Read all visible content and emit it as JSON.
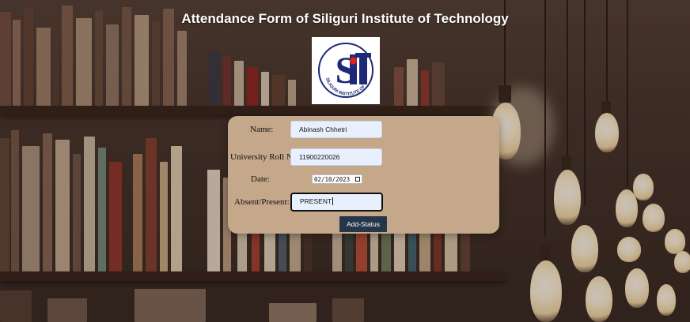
{
  "header": {
    "title": "Attendance Form of Siliguri Institute of Technology"
  },
  "logo": {
    "letters": "SIT",
    "ring_text": "SILIGURI INSTITUTE OF TECHNOLOGY",
    "accent": "#e2231a",
    "brand": "#1e2a78"
  },
  "form": {
    "name_label": "Name:",
    "name_value": "Abinash Chhetri",
    "roll_label": "University Roll No:",
    "roll_value": "11900220026",
    "date_label": "Date:",
    "date_value": "02/10/2023",
    "status_label": "Absent/Present:",
    "status_value": "PRESENT",
    "submit_label": "Add-Status"
  },
  "colors": {
    "card": "#c5a78a",
    "button": "#24364a",
    "input_bg": "#e8f0fe"
  }
}
